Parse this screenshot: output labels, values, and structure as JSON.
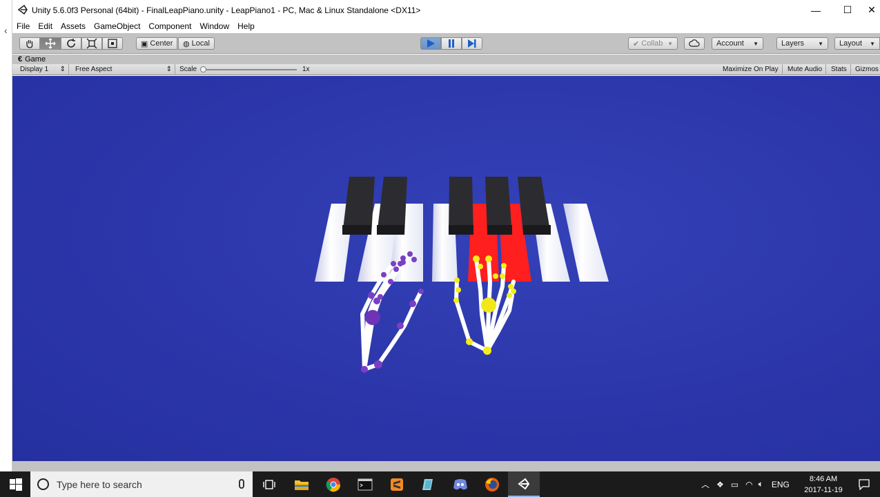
{
  "window": {
    "title": "Unity 5.6.0f3 Personal (64bit) - FinalLeapPiano.unity - LeapPiano1 - PC, Mac & Linux Standalone <DX11>",
    "minimize": "—",
    "maximize": "☐",
    "close": "✕"
  },
  "menu": [
    "File",
    "Edit",
    "Assets",
    "GameObject",
    "Component",
    "Window",
    "Help"
  ],
  "toolbar": {
    "pivot_center": "Center",
    "pivot_local": "Local",
    "collab": "Collab",
    "account": "Account",
    "layers": "Layers",
    "layout": "Layout"
  },
  "game_tab": {
    "label": "Game"
  },
  "game_bar": {
    "display": "Display 1",
    "aspect": "Free Aspect",
    "scale_label": "Scale",
    "scale_value": "1x",
    "maximize_on_play": "Maximize On Play",
    "mute_audio": "Mute Audio",
    "stats": "Stats",
    "gizmos": "Gizmos"
  },
  "taskbar": {
    "search_placeholder": "Type here to search",
    "language": "ENG",
    "time": "8:46 AM",
    "date": "2017-11-19"
  },
  "colors": {
    "scene_bg": "#2b35a8",
    "pressed_key": "#ff2020",
    "left_joint": "#7b3fc4",
    "right_joint": "#f4ee1a",
    "play_active": "#6c93c4"
  }
}
